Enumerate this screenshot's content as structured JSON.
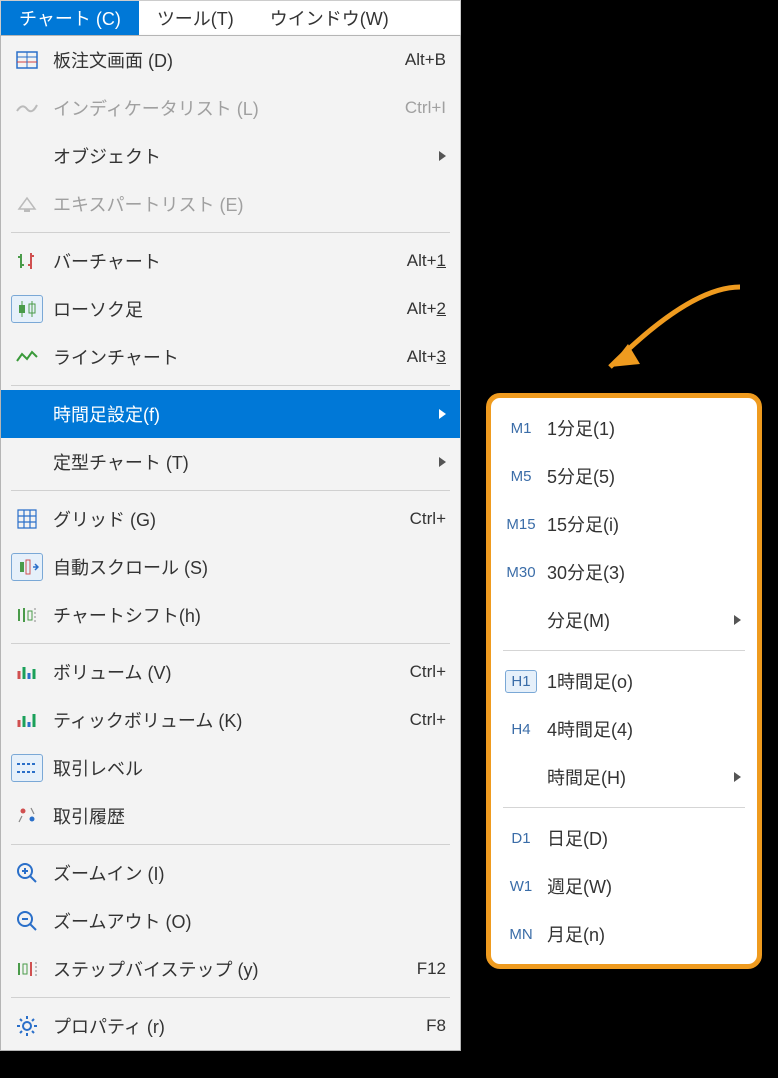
{
  "menubar": {
    "items": [
      {
        "label": "チャート (C)",
        "active": true
      },
      {
        "label": "ツール(T)",
        "active": false
      },
      {
        "label": "ウインドウ(W)",
        "active": false
      }
    ]
  },
  "menu": [
    {
      "type": "item",
      "icon": "dom-icon",
      "label": "板注文画面 (D)",
      "shortcut": "Alt+B"
    },
    {
      "type": "item",
      "icon": "indicator-icon",
      "label": "インディケータリスト (L)",
      "shortcut": "Ctrl+I",
      "disabled": true
    },
    {
      "type": "item",
      "icon": "",
      "label": "オブジェクト",
      "submenu": true
    },
    {
      "type": "item",
      "icon": "expert-icon",
      "label": "エキスパートリスト (E)",
      "disabled": true
    },
    {
      "type": "sep"
    },
    {
      "type": "item",
      "icon": "bar-chart-icon",
      "label": "バーチャート",
      "shortcut": "Alt+1"
    },
    {
      "type": "item",
      "icon": "candle-icon",
      "label": "ローソク足",
      "shortcut": "Alt+2",
      "boxed": true
    },
    {
      "type": "item",
      "icon": "line-chart-icon",
      "label": "ラインチャート",
      "shortcut": "Alt+3"
    },
    {
      "type": "sep"
    },
    {
      "type": "item",
      "icon": "",
      "label": "時間足設定(f)",
      "submenu": true,
      "selected": true
    },
    {
      "type": "item",
      "icon": "",
      "label": "定型チャート (T)",
      "submenu": true
    },
    {
      "type": "sep"
    },
    {
      "type": "item",
      "icon": "grid-icon",
      "label": "グリッド (G)",
      "shortcut": "Ctrl+"
    },
    {
      "type": "item",
      "icon": "autoscroll-icon",
      "label": "自動スクロール (S)",
      "boxed": true
    },
    {
      "type": "item",
      "icon": "shift-icon",
      "label": "チャートシフト(h)"
    },
    {
      "type": "sep"
    },
    {
      "type": "item",
      "icon": "volume-icon",
      "label": "ボリューム (V)",
      "shortcut": "Ctrl+"
    },
    {
      "type": "item",
      "icon": "tick-volume-icon",
      "label": "ティックボリューム (K)",
      "shortcut": "Ctrl+"
    },
    {
      "type": "item",
      "icon": "levels-icon",
      "label": "取引レベル",
      "boxed": true
    },
    {
      "type": "item",
      "icon": "history-icon",
      "label": "取引履歴"
    },
    {
      "type": "sep"
    },
    {
      "type": "item",
      "icon": "zoom-in-icon",
      "label": "ズームイン (I)"
    },
    {
      "type": "item",
      "icon": "zoom-out-icon",
      "label": "ズームアウト (O)"
    },
    {
      "type": "item",
      "icon": "step-icon",
      "label": "ステップバイステップ (y)",
      "shortcut": "F12"
    },
    {
      "type": "sep"
    },
    {
      "type": "item",
      "icon": "gear-icon",
      "label": "プロパティ (r)",
      "shortcut": "F8"
    }
  ],
  "submenu": [
    {
      "type": "item",
      "tf": "M1",
      "label": "1分足(1)"
    },
    {
      "type": "item",
      "tf": "M5",
      "label": "5分足(5)"
    },
    {
      "type": "item",
      "tf": "M15",
      "label": "15分足(i)"
    },
    {
      "type": "item",
      "tf": "M30",
      "label": "30分足(3)"
    },
    {
      "type": "item",
      "tf": "",
      "label": "分足(M)",
      "submenu": true
    },
    {
      "type": "sep"
    },
    {
      "type": "item",
      "tf": "H1",
      "label": "1時間足(o)",
      "boxed": true
    },
    {
      "type": "item",
      "tf": "H4",
      "label": "4時間足(4)"
    },
    {
      "type": "item",
      "tf": "",
      "label": "時間足(H)",
      "submenu": true
    },
    {
      "type": "sep"
    },
    {
      "type": "item",
      "tf": "D1",
      "label": "日足(D)"
    },
    {
      "type": "item",
      "tf": "W1",
      "label": "週足(W)"
    },
    {
      "type": "item",
      "tf": "MN",
      "label": "月足(n)"
    }
  ]
}
